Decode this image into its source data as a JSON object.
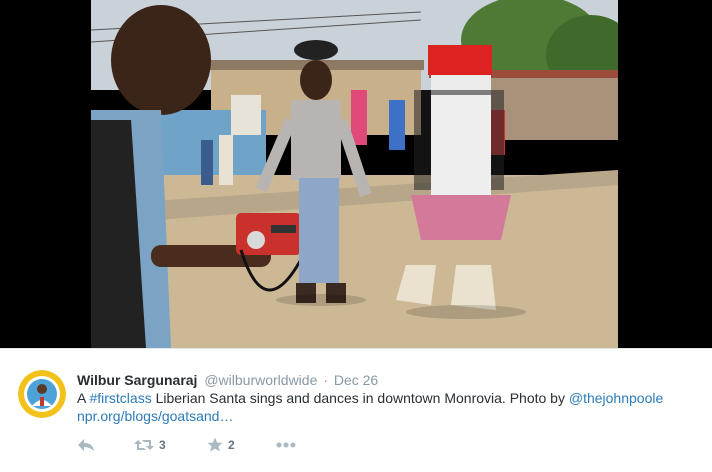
{
  "media": {
    "description_icon": "photo-liberian-santa",
    "radio_brand": "radio"
  },
  "tweet": {
    "avatar_icon": "profile-avatar",
    "fullname": "Wilbur Sargunaraj",
    "username": "@wilburworldwide",
    "separator": "·",
    "timestamp": "Dec 26",
    "text": {
      "prefix": "A ",
      "hashtag": "#firstclass",
      "middle": " Liberian Santa sings and dances in downtown Monrovia. Photo by ",
      "mention": "@thejohnpoole",
      "url": "npr.org/blogs/goatsand…"
    },
    "actions": {
      "reply_icon": "reply-icon",
      "retweet_icon": "retweet-icon",
      "retweet_count": "3",
      "favorite_icon": "star-icon",
      "favorite_count": "2",
      "more_icon": "more-icon"
    }
  },
  "colors": {
    "link": "#2b7bb9",
    "muted": "#8899a6",
    "icon": "#aab8c2"
  }
}
